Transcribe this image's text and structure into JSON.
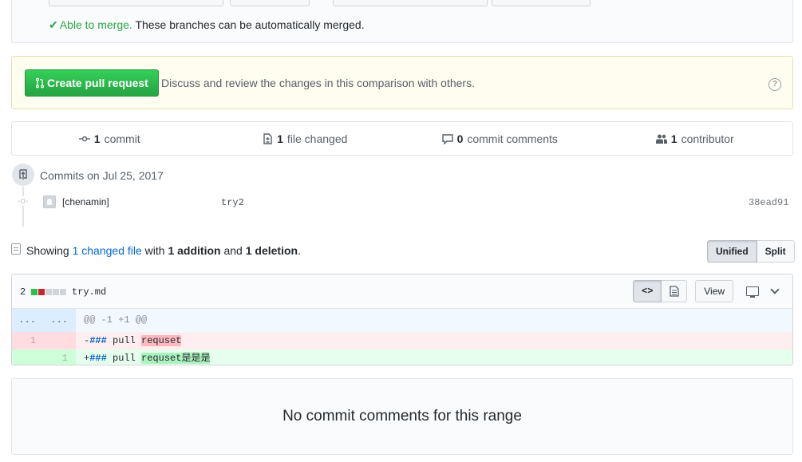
{
  "merge": {
    "status_ok": "Able to merge.",
    "status_text": "These branches can be automatically merged."
  },
  "create": {
    "button_label": "Create pull request",
    "description": "Discuss and review the changes in this comparison with others.",
    "help": "?"
  },
  "summary": {
    "commits_count": "1",
    "commits_label": "commit",
    "files_count": "1",
    "files_label": "file changed",
    "comments_count": "0",
    "comments_label": "commit comments",
    "contributors_count": "1",
    "contributors_label": "contributor"
  },
  "commits": {
    "title": "Commits on Jul 25, 2017",
    "items": [
      {
        "author": "[chenamin]",
        "message": "try2",
        "sha": "38ead91"
      }
    ]
  },
  "toc": {
    "prefix": "Showing",
    "link": "1 changed file",
    "with": "with",
    "additions": "1 addition",
    "and": "and",
    "deletions": "1 deletion",
    "period": ".",
    "unified": "Unified",
    "split": "Split"
  },
  "file": {
    "diffstat_num": "2",
    "name": "try.md",
    "code_label": "<>",
    "view_label": "View",
    "hunk_left": "...",
    "hunk_right": "...",
    "hunk_header": "@@ -1 +1 @@",
    "del_line_num": "1",
    "del_prefix": "-",
    "del_kw": "###",
    "del_text": " pull ",
    "del_hl": "requset",
    "add_line_num": "1",
    "add_prefix": "+",
    "add_kw": "###",
    "add_text": " pull ",
    "add_hl": "requset是是是"
  },
  "comments": {
    "empty_text": "No commit comments for this range"
  },
  "colors": {
    "green": "#28a745",
    "link": "#0366d6",
    "add_square": "#2cbe4e",
    "del_square": "#cb2431"
  }
}
